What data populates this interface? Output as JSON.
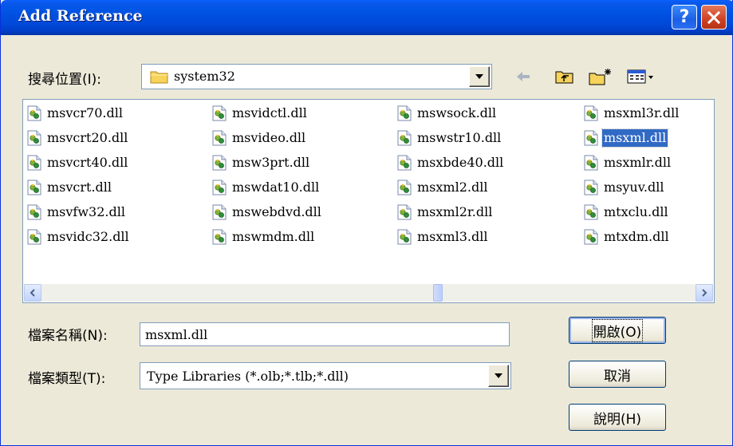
{
  "window": {
    "title": "Add Reference",
    "help_symbol": "?",
    "colors": {
      "titlebar": "#0055e5",
      "dialog_bg": "#ece9d8",
      "selection": "#316ac5"
    }
  },
  "look_in": {
    "label": "搜尋位置(I):",
    "value": "system32",
    "icon": "folder-icon"
  },
  "toolbar": {
    "icons": [
      "back-arrow-icon",
      "up-folder-icon",
      "new-folder-icon",
      "view-menu-icon"
    ]
  },
  "file_list": {
    "columns": [
      [
        "msvcr70.dll",
        "msvcrt20.dll",
        "msvcrt40.dll",
        "msvcrt.dll",
        "msvfw32.dll",
        "msvidc32.dll"
      ],
      [
        "msvidctl.dll",
        "msvideo.dll",
        "msw3prt.dll",
        "mswdat10.dll",
        "mswebdvd.dll",
        "mswmdm.dll"
      ],
      [
        "mswsock.dll",
        "mswstr10.dll",
        "msxbde40.dll",
        "msxml2.dll",
        "msxml2r.dll",
        "msxml3.dll"
      ],
      [
        "msxml3r.dll",
        "msxml.dll",
        "msxmlr.dll",
        "msyuv.dll",
        "mtxclu.dll",
        "mtxdm.dll"
      ]
    ],
    "selected": "msxml.dll",
    "file_icon": "dll-file-icon"
  },
  "file_name": {
    "label": "檔案名稱(N):",
    "value": "msxml.dll"
  },
  "file_type": {
    "label": "檔案類型(T):",
    "value": "Type Libraries (*.olb;*.tlb;*.dll)"
  },
  "buttons": {
    "open": "開啟(O)",
    "cancel": "取消",
    "help": "說明(H)"
  }
}
